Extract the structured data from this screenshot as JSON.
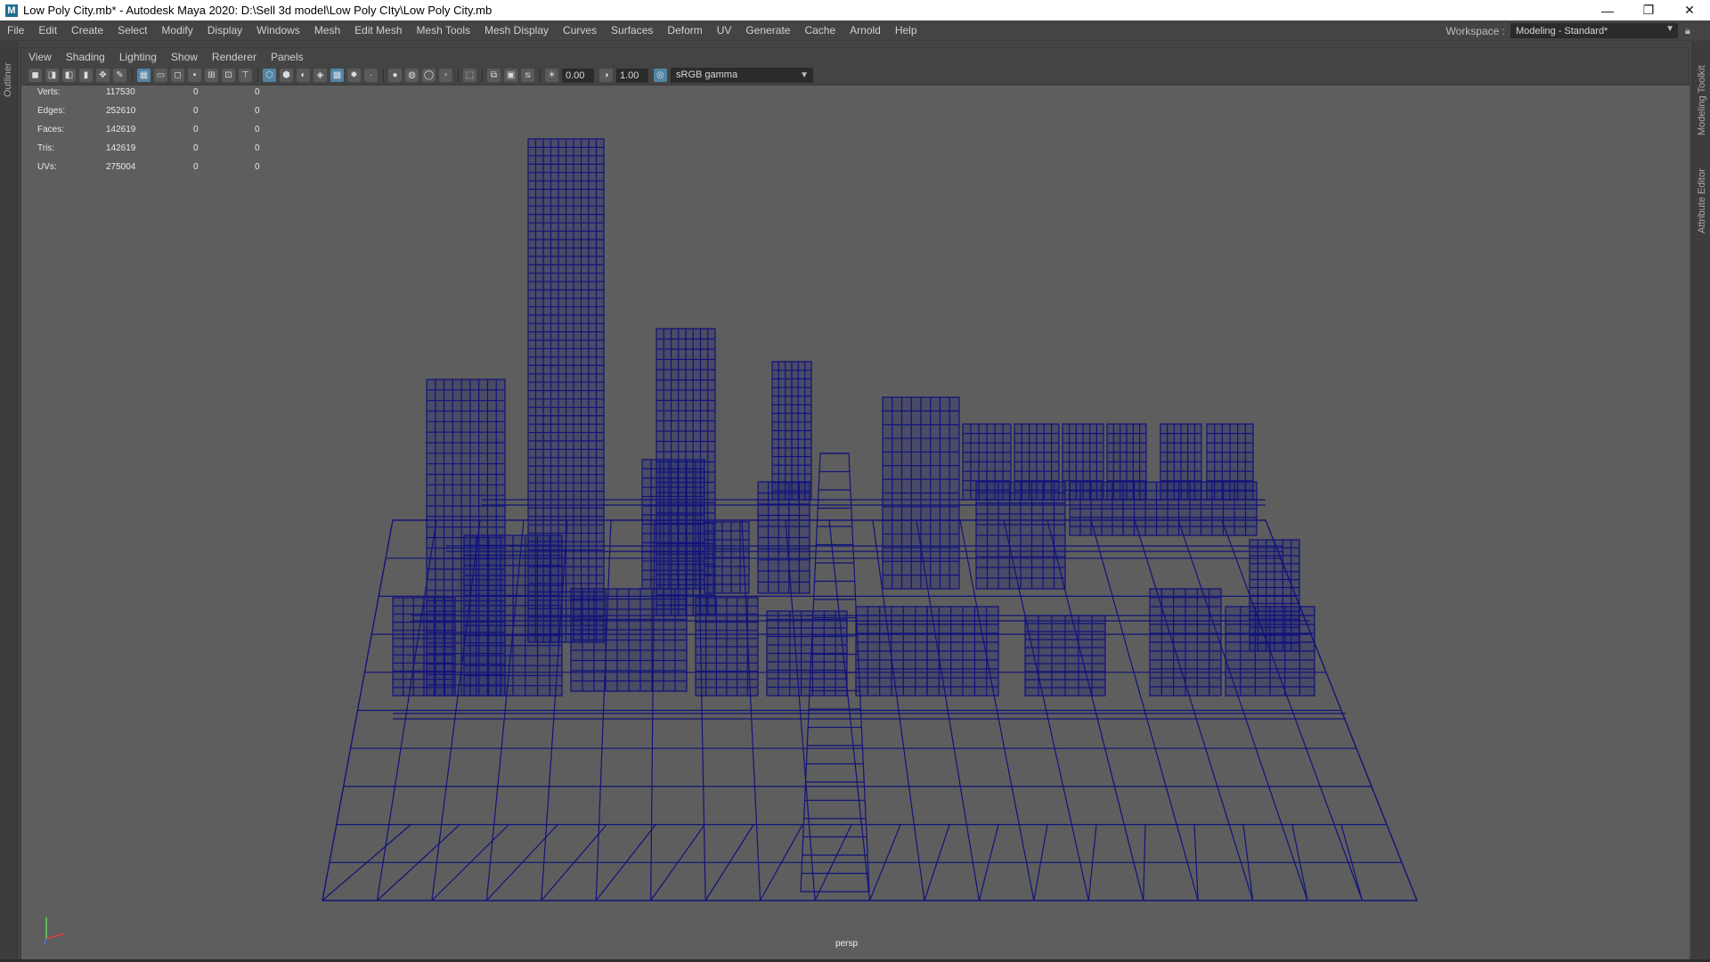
{
  "window": {
    "title": "Low Poly City.mb* - Autodesk Maya 2020: D:\\Sell 3d model\\Low Poly CIty\\Low Poly City.mb",
    "app_icon_glyph": "M",
    "controls": {
      "minimize": "—",
      "restore": "❐",
      "close": "✕"
    }
  },
  "menubar": {
    "items": [
      "File",
      "Edit",
      "Create",
      "Select",
      "Modify",
      "Display",
      "Windows",
      "Mesh",
      "Edit Mesh",
      "Mesh Tools",
      "Mesh Display",
      "Curves",
      "Surfaces",
      "Deform",
      "UV",
      "Generate",
      "Cache",
      "Arnold",
      "Help"
    ],
    "workspace_label": "Workspace :",
    "workspace_value": "Modeling - Standard*"
  },
  "side_tabs": {
    "left": "Outliner",
    "right_top": "Modeling Toolkit",
    "right_bottom": "Attribute Editor"
  },
  "panel": {
    "menu": [
      "View",
      "Shading",
      "Lighting",
      "Show",
      "Renderer",
      "Panels"
    ],
    "toolbar": {
      "exposure_value": "0.00",
      "gamma_value": "1.00",
      "color_space": "sRGB gamma"
    },
    "hud": [
      {
        "label": "Verts:",
        "v1": "117530",
        "v2": "0",
        "v3": "0"
      },
      {
        "label": "Edges:",
        "v1": "252610",
        "v2": "0",
        "v3": "0"
      },
      {
        "label": "Faces:",
        "v1": "142619",
        "v2": "0",
        "v3": "0"
      },
      {
        "label": "Tris:",
        "v1": "142619",
        "v2": "0",
        "v3": "0"
      },
      {
        "label": "UVs:",
        "v1": "275004",
        "v2": "0",
        "v3": "0"
      }
    ],
    "camera_label": "persp",
    "wire_color": "#11137a",
    "viewport_bg": "#5e5e5e"
  }
}
